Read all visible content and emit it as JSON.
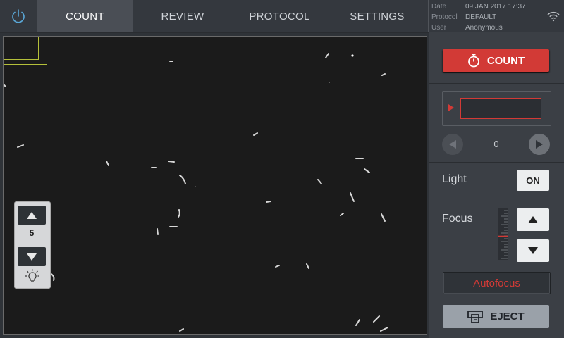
{
  "tabs": [
    {
      "label": "COUNT",
      "active": true
    },
    {
      "label": "REVIEW",
      "active": false
    },
    {
      "label": "PROTOCOL",
      "active": false
    },
    {
      "label": "SETTINGS",
      "active": false
    }
  ],
  "info": {
    "date_key": "Date",
    "date_value": "09 JAN 2017 17:37",
    "protocol_key": "Protocol",
    "protocol_value": "DEFAULT",
    "user_key": "User",
    "user_value": "Anonymous"
  },
  "icons": {
    "power": "power-icon",
    "wifi": "wifi-icon",
    "stopwatch": "stopwatch-icon",
    "eject": "eject-icon",
    "bulb": "light-bulb-icon"
  },
  "brightness": {
    "value": "5"
  },
  "panel": {
    "count_label": "COUNT",
    "result_index": "0",
    "light_label": "Light",
    "light_state": "ON",
    "focus_label": "Focus",
    "focus_level": 0.55,
    "autofocus_label": "Autofocus",
    "eject_label": "EJECT"
  },
  "colors": {
    "accent_red": "#d23a36",
    "active_tab": "#4a4e55",
    "icon_blue": "#5aa8d8",
    "minimap": "#b5c03a"
  }
}
